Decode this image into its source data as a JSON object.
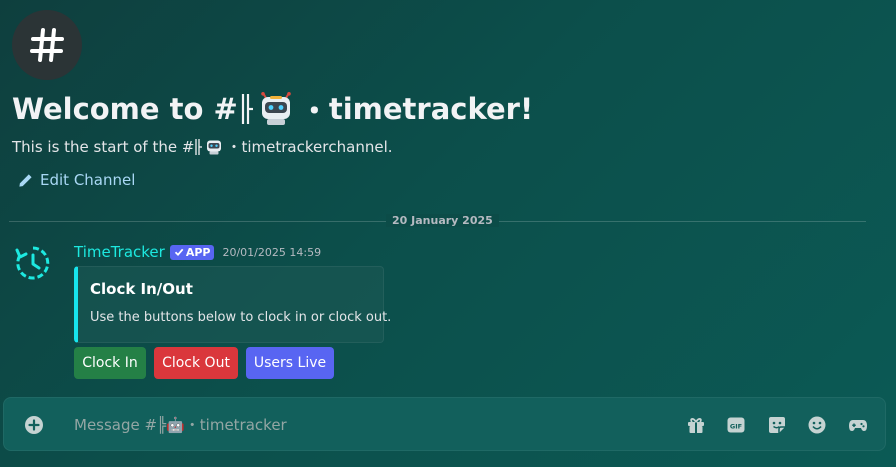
{
  "channel": {
    "hash_glyph": "#",
    "title_prefix": "Welcome to #",
    "name_separator": "・",
    "name": "timetracker",
    "title_suffix": "!",
    "start_prefix": "This is the start of the #",
    "start_suffix": " channel.",
    "edit_label": "Edit Channel"
  },
  "divider": {
    "date": "20 January 2025"
  },
  "message": {
    "author": "TimeTracker",
    "badge": "APP",
    "timestamp": "20/01/2025 14:59",
    "embed": {
      "title": "Clock In/Out",
      "description": "Use the buttons below to clock in or clock out."
    },
    "buttons": [
      {
        "label": "Clock In",
        "color": "#248046"
      },
      {
        "label": "Clock Out",
        "color": "#da373c"
      },
      {
        "label": "Users Live",
        "color": "#5865f2"
      }
    ]
  },
  "composer": {
    "placeholder_prefix": "Message #",
    "placeholder_name": "・timetracker",
    "placeholder": "Message #╠🤖・timetracker"
  },
  "icons": [
    "hashtag-icon",
    "robot-icon",
    "pencil-icon",
    "clock-icon",
    "check-icon",
    "plus-icon",
    "gift-icon",
    "gif-icon",
    "sticker-icon",
    "emoji-icon",
    "gamepad-icon"
  ],
  "colors": {
    "accent": "#1de9e0",
    "blurple": "#5865f2",
    "link": "#a9d8f5"
  }
}
